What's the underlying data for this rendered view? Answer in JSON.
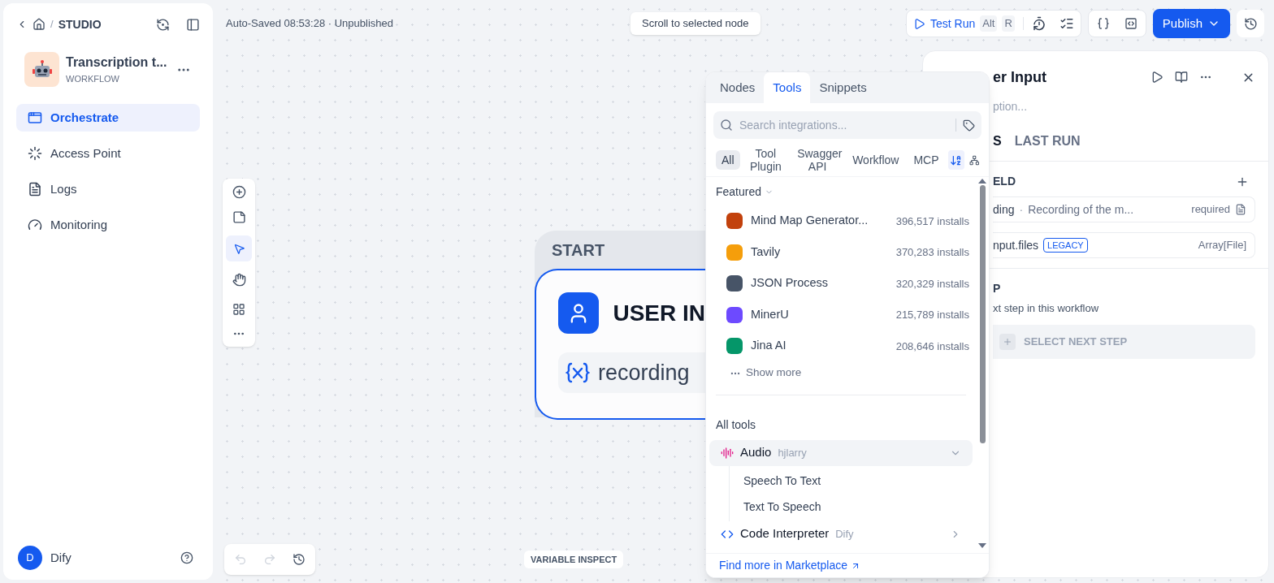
{
  "breadcrumb": {
    "separator": "/",
    "section": "STUDIO"
  },
  "app": {
    "name": "Transcription t...",
    "type": "WORKFLOW"
  },
  "nav": [
    {
      "label": "Orchestrate",
      "selected": true
    },
    {
      "label": "Access Point",
      "selected": false
    },
    {
      "label": "Logs",
      "selected": false
    },
    {
      "label": "Monitoring",
      "selected": false
    }
  ],
  "user": {
    "initial": "D",
    "name": "Dify"
  },
  "status": "Auto-Saved 08:53:28 · Unpublished",
  "scroll_button": "Scroll to selected node",
  "test_run": {
    "label": "Test Run",
    "keys": [
      "Alt",
      "R"
    ]
  },
  "publish": "Publish",
  "node": {
    "header": "START",
    "title": "USER IN",
    "variable": "recording"
  },
  "variable_inspect": "VARIABLE INSPECT",
  "picker": {
    "tabs": [
      {
        "label": "Nodes",
        "selected": false
      },
      {
        "label": "Tools",
        "selected": true
      },
      {
        "label": "Snippets",
        "selected": false
      }
    ],
    "search_placeholder": "Search integrations...",
    "filters": [
      {
        "label": "All",
        "selected": true
      },
      {
        "label": "Tool Plugin",
        "selected": false
      },
      {
        "label": "Swagger API",
        "selected": false
      },
      {
        "label": "Workflow",
        "selected": false
      },
      {
        "label": "MCP",
        "selected": false
      }
    ],
    "featured_title": "Featured",
    "featured": [
      {
        "name": "Mind Map Generator...",
        "installs": "396,517 installs",
        "color": "#c2410c"
      },
      {
        "name": "Tavily",
        "installs": "370,283 installs",
        "color": "#f59e0b"
      },
      {
        "name": "JSON Process",
        "installs": "320,329 installs",
        "color": "#475467"
      },
      {
        "name": "MinerU",
        "installs": "215,789 installs",
        "color": "#6d4aff"
      },
      {
        "name": "Jina AI",
        "installs": "208,646 installs",
        "color": "#059669"
      }
    ],
    "show_more": "Show more",
    "all_tools_title": "All tools",
    "tools": [
      {
        "name": "Audio",
        "author": "hjlarry",
        "kind": "audio",
        "expanded": true,
        "children": [
          {
            "name": "Speech To Text"
          },
          {
            "name": "Text To Speech"
          }
        ]
      },
      {
        "name": "Code Interpreter",
        "author": "Dify",
        "kind": "code",
        "expanded": false
      }
    ],
    "marketplace_link": "Find more in Marketplace"
  },
  "panel": {
    "title": "er Input",
    "description_placeholder": "ption...",
    "tabs": [
      {
        "label": "S",
        "selected": true
      },
      {
        "label": "LAST RUN",
        "selected": false
      }
    ],
    "section_title": "ELD",
    "fields": [
      {
        "name": "ding",
        "separator": "·",
        "description": "Recording of the m...",
        "meta": "required"
      },
      {
        "name": "nput.files",
        "tag": "LEGACY",
        "meta": "Array[File]"
      }
    ],
    "next_title": "P",
    "next_hint": "xt step in this workflow",
    "next_button": "SELECT NEXT STEP"
  }
}
